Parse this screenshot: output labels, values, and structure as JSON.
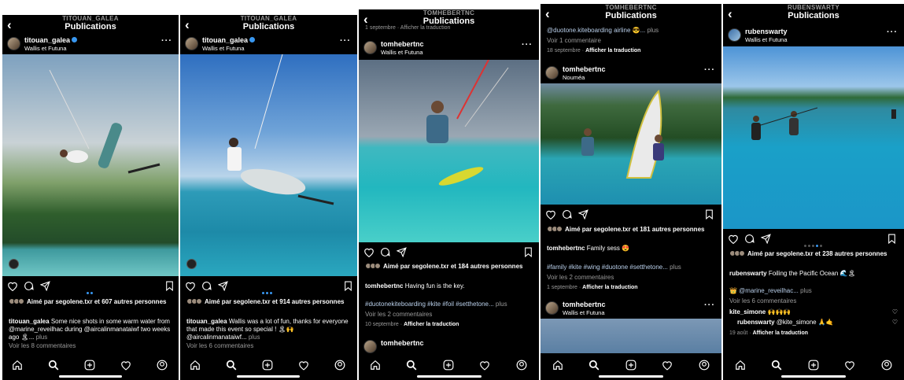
{
  "screens": [
    {
      "account": "TITOUAN_GALEA",
      "title": "Publications",
      "post": {
        "user": "titouan_galea",
        "location": "Wallis et Futuna",
        "liked_by": "segolene.txr",
        "likes_others": "607 autres personnes",
        "caption_user": "titouan_galea",
        "caption": "Some nice shots in some warm water from @marine_reveilhac  during @aircalinmanataiwf two weeks ago 🏝... ",
        "more": "plus",
        "comments": "Voir les 8 commentaires"
      }
    },
    {
      "account": "TITOUAN_GALEA",
      "title": "Publications",
      "post": {
        "user": "titouan_galea",
        "location": "Wallis et Futuna",
        "liked_by": "segolene.txr",
        "likes_others": "914 autres personnes",
        "caption_user": "titouan_galea",
        "caption": "Wallis was a lot of fun, thanks for everyone that made this event so special ! 🏝🙌 @aircalinmanataiwf...",
        "more": "plus",
        "comments": "Voir les 6 commentaires"
      }
    },
    {
      "account": "TOMHEBERTNC",
      "title": "Publications",
      "top_partial": "1 septembre · Afficher la traduction",
      "post": {
        "user": "tomhebertnc",
        "location": "Wallis et Futuna",
        "liked_by": "segolene.txr",
        "likes_others": "184 autres personnes",
        "caption_user": "tomhebertnc",
        "caption": "Having fun is the key.",
        "hashtags": "#duotonekiteboarding #kite #foil #setthetone...",
        "more": "plus",
        "comments": "Voir les 2 commentaires",
        "date": "10 septembre",
        "translate": "Afficher la traduction"
      },
      "next_user": "tomhebertnc"
    },
    {
      "account": "TOMHEBERTNC",
      "title": "Publications",
      "top_partial": "@duotone.kiteboarding airline 😎... ",
      "top_more": "plus",
      "top_comments": "Voir 1 commentaire",
      "top_date": "18 septembre",
      "top_translate": "Afficher la traduction",
      "post": {
        "user": "tomhebertnc",
        "location": "Nouméa",
        "liked_by": "segolene.txr",
        "likes_others": "181 autres personnes",
        "caption_user": "tomhebertnc",
        "caption": "Family sess 😍",
        "hashtags": "#family #kite #wing #duotone #setthetone...",
        "more": "plus",
        "comments": "Voir les 2 commentaires",
        "date": "1 septembre",
        "translate": "Afficher la traduction"
      },
      "next_user": "tomhebertnc",
      "next_location": "Wallis et Futuna"
    },
    {
      "account": "RUBENSWARTY",
      "title": "Publications",
      "post": {
        "user": "rubenswarty",
        "location": "Wallis et Futuna",
        "liked_by": "segolene.txr",
        "likes_others": "238 autres personnes",
        "caption_user": "rubenswarty",
        "caption": "Foiling the Pacific Ocean 🌊🏝",
        "tagged": "👑 @marine_reveilhac...",
        "more": "plus",
        "comments": "Voir les 6 commentaires",
        "c1_user": "kite_simone",
        "c1_text": "🙌🙌🙌",
        "c2_user": "rubenswarty",
        "c2_text": "@kite_simone 🙏🤙",
        "date": "19 août",
        "translate": "Afficher la traduction"
      }
    }
  ],
  "like_prefix": "Aimé par",
  "like_join": "et",
  "nav_icons": [
    "home-icon",
    "search-icon",
    "new-post-icon",
    "activity-icon",
    "profile-icon"
  ],
  "colors": {
    "background": "#000000",
    "secondary_text": "#9a9a9a",
    "verified": "#3897f0"
  }
}
